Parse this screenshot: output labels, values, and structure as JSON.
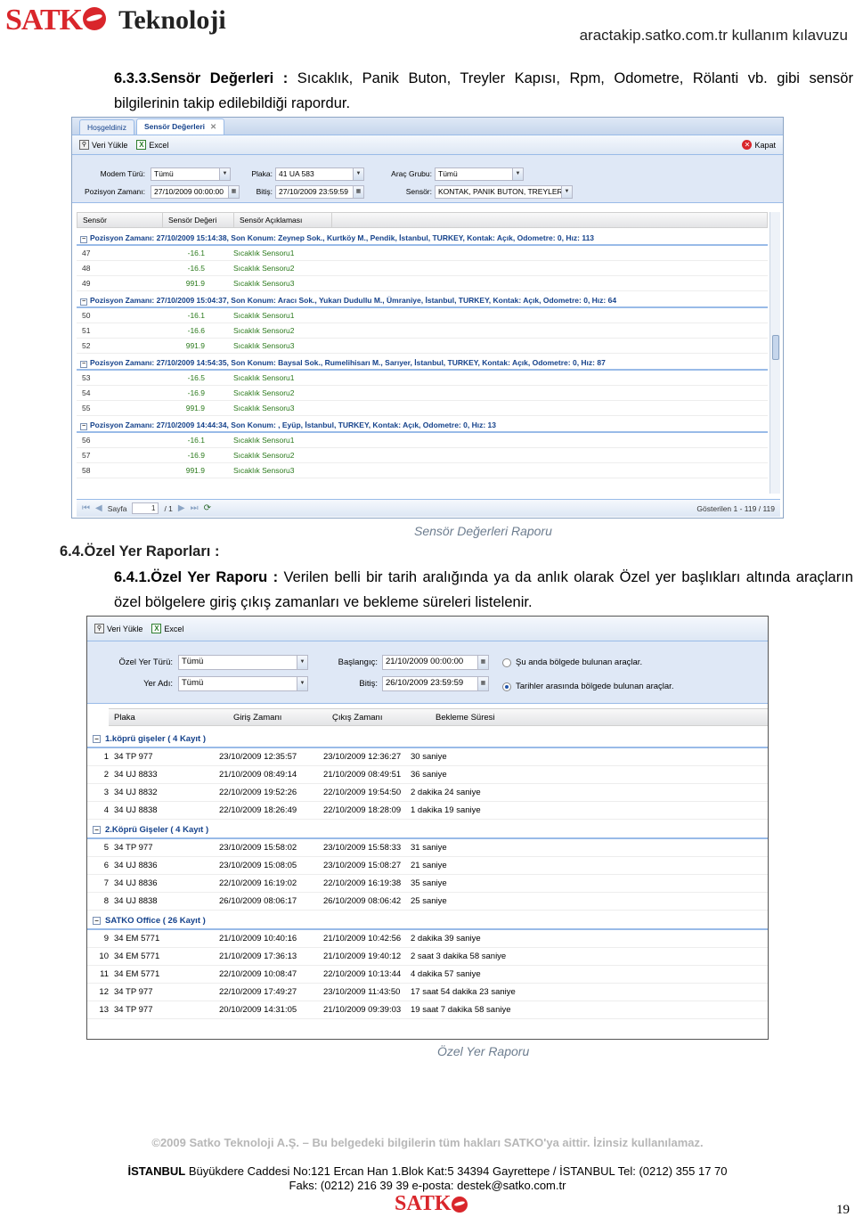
{
  "header": {
    "logo_text_a": "SATK",
    "logo_text_b": "Teknoloji",
    "site": "aractakip.satko.com.tr kullanım kılavuzu"
  },
  "section_633": {
    "heading": "6.3.3.Sensör Değerleri :",
    "text": "Sıcaklık, Panik Buton, Treyler Kapısı, Rpm, Odometre, Rölanti vb. gibi sensör bilgilerinin takip edilebildiği rapordur."
  },
  "shot1": {
    "tabs": [
      "Hoşgeldiniz",
      "Sensör Değerleri"
    ],
    "toolbar": {
      "load": "Veri Yükle",
      "excel": "Excel",
      "close": "Kapat"
    },
    "filters": {
      "modem_label": "Modem Türü:",
      "modem_value": "Tümü",
      "plaka_label": "Plaka:",
      "plaka_value": "41 UA 583",
      "arac_grubu_label": "Araç Grubu:",
      "arac_grubu_value": "Tümü",
      "pozisyon_label": "Pozisyon Zamanı:",
      "pozisyon_value": "27/10/2009 00:00:00",
      "bitis_label": "Bitiş:",
      "bitis_value": "27/10/2009 23:59:59",
      "sensor_label": "Sensör:",
      "sensor_value": "KONTAK, PANIK BUTON, TREYLER K..."
    },
    "columns": [
      "Sensör",
      "Sensör Değeri",
      "Sensör Açıklaması"
    ],
    "groups": [
      {
        "title": "Pozisyon Zamanı: 27/10/2009 15:14:38, Son Konum: Zeynep Sok., Kurtköy M., Pendik, İstanbul, TURKEY, Kontak: Açık, Odometre: 0, Hız: 113",
        "rows": [
          [
            "47",
            "-16.1",
            "Sıcaklık Sensoru1"
          ],
          [
            "48",
            "-16.5",
            "Sıcaklık Sensoru2"
          ],
          [
            "49",
            "991.9",
            "Sıcaklık Sensoru3"
          ]
        ]
      },
      {
        "title": "Pozisyon Zamanı: 27/10/2009 15:04:37, Son Konum: Aracı Sok., Yukarı Dudullu M., Ümraniye, İstanbul, TURKEY, Kontak: Açık, Odometre: 0, Hız: 64",
        "rows": [
          [
            "50",
            "-16.1",
            "Sıcaklık Sensoru1"
          ],
          [
            "51",
            "-16.6",
            "Sıcaklık Sensoru2"
          ],
          [
            "52",
            "991.9",
            "Sıcaklık Sensoru3"
          ]
        ]
      },
      {
        "title": "Pozisyon Zamanı: 27/10/2009 14:54:35, Son Konum: Baysal Sok., Rumelihisarı M., Sarıyer, İstanbul, TURKEY, Kontak: Açık, Odometre: 0, Hız: 87",
        "rows": [
          [
            "53",
            "-16.5",
            "Sıcaklık Sensoru1"
          ],
          [
            "54",
            "-16.9",
            "Sıcaklık Sensoru2"
          ],
          [
            "55",
            "991.9",
            "Sıcaklık Sensoru3"
          ]
        ]
      },
      {
        "title": "Pozisyon Zamanı: 27/10/2009 14:44:34, Son Konum: , Eyüp, İstanbul, TURKEY, Kontak: Açık, Odometre: 0, Hız: 13",
        "rows": [
          [
            "56",
            "-16.1",
            "Sıcaklık Sensoru1"
          ],
          [
            "57",
            "-16.9",
            "Sıcaklık Sensoru2"
          ],
          [
            "58",
            "991.9",
            "Sıcaklık Sensoru3"
          ]
        ]
      }
    ],
    "pager": {
      "page_label": "Sayfa",
      "page_value": "1",
      "of": "/ 1",
      "info": "Gösterilen 1 - 119 / 119"
    },
    "caption": "Sensör Değerleri Raporu"
  },
  "section_64": {
    "heading": "6.4.Özel Yer Raporları :"
  },
  "section_641": {
    "heading": "6.4.1.Özel Yer Raporu :",
    "text": "Verilen belli bir tarih aralığında ya da anlık olarak Özel yer başlıkları altında araçların özel bölgelere giriş çıkış zamanları ve bekleme süreleri listelenir."
  },
  "shot2": {
    "toolbar": {
      "load": "Veri Yükle",
      "excel": "Excel"
    },
    "filters": {
      "tur_label": "Özel Yer Türü:",
      "tur_value": "Tümü",
      "ad_label": "Yer Adı:",
      "ad_value": "Tümü",
      "baslangic_label": "Başlangıç:",
      "baslangic_value": "21/10/2009 00:00:00",
      "bitis_label": "Bitiş:",
      "bitis_value": "26/10/2009 23:59:59",
      "radio1": "Şu anda bölgede bulunan araçlar.",
      "radio2": "Tarihler arasında bölgede bulunan araçlar."
    },
    "columns": [
      "Plaka",
      "Giriş Zamanı",
      "Çıkış Zamanı",
      "Bekleme Süresi"
    ],
    "groups": [
      {
        "title": "1.köprü gişeler ( 4 Kayıt )",
        "rows": [
          [
            "1",
            "34 TP 977",
            "23/10/2009 12:35:57",
            "23/10/2009 12:36:27",
            "30 saniye"
          ],
          [
            "2",
            "34 UJ 8833",
            "21/10/2009 08:49:14",
            "21/10/2009 08:49:51",
            "36 saniye"
          ],
          [
            "3",
            "34 UJ 8832",
            "22/10/2009 19:52:26",
            "22/10/2009 19:54:50",
            "2 dakika 24 saniye"
          ],
          [
            "4",
            "34 UJ 8838",
            "22/10/2009 18:26:49",
            "22/10/2009 18:28:09",
            "1 dakika 19 saniye"
          ]
        ]
      },
      {
        "title": "2.Köprü Gişeler ( 4 Kayıt )",
        "rows": [
          [
            "5",
            "34 TP 977",
            "23/10/2009 15:58:02",
            "23/10/2009 15:58:33",
            "31 saniye"
          ],
          [
            "6",
            "34 UJ 8836",
            "23/10/2009 15:08:05",
            "23/10/2009 15:08:27",
            "21 saniye"
          ],
          [
            "7",
            "34 UJ 8836",
            "22/10/2009 16:19:02",
            "22/10/2009 16:19:38",
            "35 saniye"
          ],
          [
            "8",
            "34 UJ 8838",
            "26/10/2009 08:06:17",
            "26/10/2009 08:06:42",
            "25 saniye"
          ]
        ]
      },
      {
        "title": "SATKO Office ( 26 Kayıt )",
        "rows": [
          [
            "9",
            "34 EM 5771",
            "21/10/2009 10:40:16",
            "21/10/2009 10:42:56",
            "2 dakika 39 saniye"
          ],
          [
            "10",
            "34 EM 5771",
            "21/10/2009 17:36:13",
            "21/10/2009 19:40:12",
            "2 saat 3 dakika 58 saniye"
          ],
          [
            "11",
            "34 EM 5771",
            "22/10/2009 10:08:47",
            "22/10/2009 10:13:44",
            "4 dakika 57 saniye"
          ],
          [
            "12",
            "34 TP 977",
            "22/10/2009 17:49:27",
            "23/10/2009 11:43:50",
            "17 saat 54 dakika 23 saniye"
          ],
          [
            "13",
            "34 TP 977",
            "20/10/2009 14:31:05",
            "21/10/2009 09:39:03",
            "19 saat 7 dakika 58 saniye"
          ]
        ]
      }
    ],
    "caption": "Özel Yer Raporu"
  },
  "footer": {
    "copyright": "©2009 Satko Teknoloji A.Ş. – Bu belgedeki bilgilerin tüm hakları SATKO'ya aittir. İzinsiz kullanılamaz.",
    "address_bold": "İSTANBUL",
    "address": "Büyükdere Caddesi No:121 Ercan Han 1.Blok Kat:5 34394 Gayrettepe / İSTANBUL Tel: (0212) 355 17 70",
    "contact": "Faks: (0212) 216 39 39 e-posta: destek@satko.com.tr",
    "logo_text": "SATK",
    "page_number": "19"
  }
}
